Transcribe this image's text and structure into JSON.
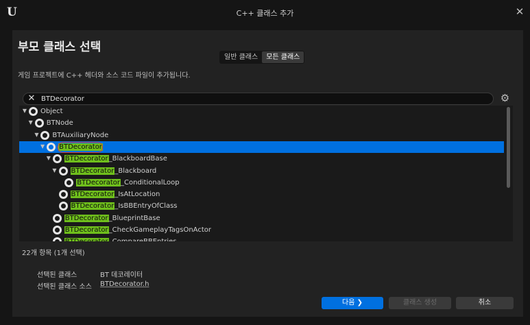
{
  "window": {
    "title": "C++ 클래스 추가",
    "close_glyph": "✕",
    "logo_text": "U"
  },
  "dialog": {
    "heading": "부모 클래스 선택",
    "toggle": [
      "일반 클래스",
      "모든 클래스"
    ],
    "active_toggle": "모든 클래스",
    "description": "게임 프로젝트에 C++ 헤더와 소스 코드 파일이 추가됩니다."
  },
  "search": {
    "value": "BTDecorator",
    "highlight_color": "#6fbf1c"
  },
  "tree": {
    "selected_color": "#0070e0",
    "rows": [
      {
        "level": 0,
        "expanded": true,
        "hl": "",
        "rest": "Object"
      },
      {
        "level": 1,
        "expanded": true,
        "hl": "",
        "rest": "BTNode"
      },
      {
        "level": 2,
        "expanded": true,
        "hl": "",
        "rest": "BTAuxiliaryNode"
      },
      {
        "level": 3,
        "expanded": true,
        "hl": "BTDecorator",
        "rest": "",
        "selected": true
      },
      {
        "level": 4,
        "expanded": true,
        "hl": "BTDecorator",
        "rest": "_BlackboardBase"
      },
      {
        "level": 5,
        "expanded": true,
        "hl": "BTDecorator",
        "rest": "_Blackboard"
      },
      {
        "level": 6,
        "expanded": null,
        "hl": "BTDecorator",
        "rest": "_ConditionalLoop"
      },
      {
        "level": 5,
        "expanded": null,
        "hl": "BTDecorator",
        "rest": "_IsAtLocation"
      },
      {
        "level": 5,
        "expanded": null,
        "hl": "BTDecorator",
        "rest": "_IsBBEntryOfClass"
      },
      {
        "level": 4,
        "expanded": null,
        "hl": "BTDecorator",
        "rest": "_BlueprintBase"
      },
      {
        "level": 4,
        "expanded": null,
        "hl": "BTDecorator",
        "rest": "_CheckGameplayTagsOnActor"
      },
      {
        "level": 4,
        "expanded": null,
        "hl": "BTDecorator",
        "rest": "_CompareBBEntries"
      }
    ]
  },
  "status": {
    "count": "22개 항목 (1개 선택)"
  },
  "selection": {
    "class_label": "선택된 클래스",
    "class_value": "BT 데코레이터",
    "source_label": "선택된 클래스 소스",
    "source_value": "BTDecorator.h"
  },
  "buttons": {
    "next": "다음 ❯",
    "create": "클래스 생성",
    "cancel": "취소"
  },
  "icons": {
    "clear": "clear-search-icon",
    "settings": "gear-icon",
    "node": "uclass-icon",
    "expand": "expand-arrow-icon"
  }
}
